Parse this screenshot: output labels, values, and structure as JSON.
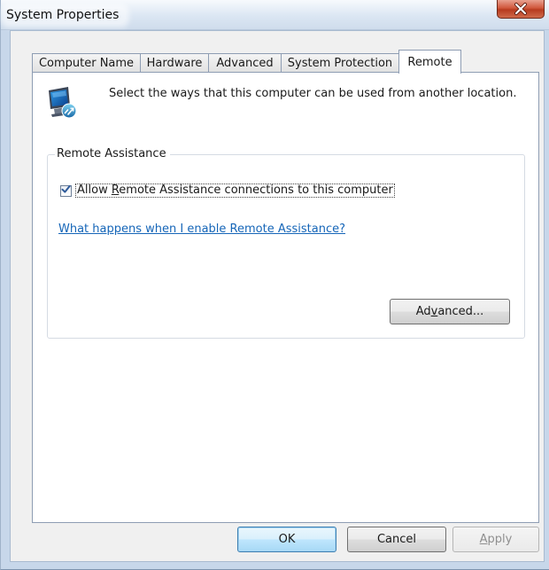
{
  "window": {
    "title": "System Properties"
  },
  "tabs": [
    {
      "label": "Computer Name",
      "active": false
    },
    {
      "label": "Hardware",
      "active": false
    },
    {
      "label": "Advanced",
      "active": false
    },
    {
      "label": "System Protection",
      "active": false
    },
    {
      "label": "Remote",
      "active": true
    }
  ],
  "remote": {
    "intro": "Select the ways that this computer can be used from another location.",
    "group_title": "Remote Assistance",
    "allow_checkbox": {
      "checked": true,
      "label_before": "Allow ",
      "label_mnemonic": "R",
      "label_after": "emote Assistance connections to this computer"
    },
    "help_link": "What happens when I enable Remote Assistance?",
    "advanced_button": {
      "before": "Ad",
      "mnemonic": "v",
      "after": "anced..."
    }
  },
  "footer": {
    "ok_label": "OK",
    "cancel_label": "Cancel",
    "apply": {
      "mnemonic": "A",
      "after": "pply",
      "enabled": false
    }
  },
  "colors": {
    "link": "#1666b8",
    "close_button": "#c9482b",
    "frame": "#c7d7ea"
  },
  "icons": {
    "close": "close-x-icon",
    "remote_computer": "remote-computer-icon",
    "check": "checkmark-icon"
  }
}
